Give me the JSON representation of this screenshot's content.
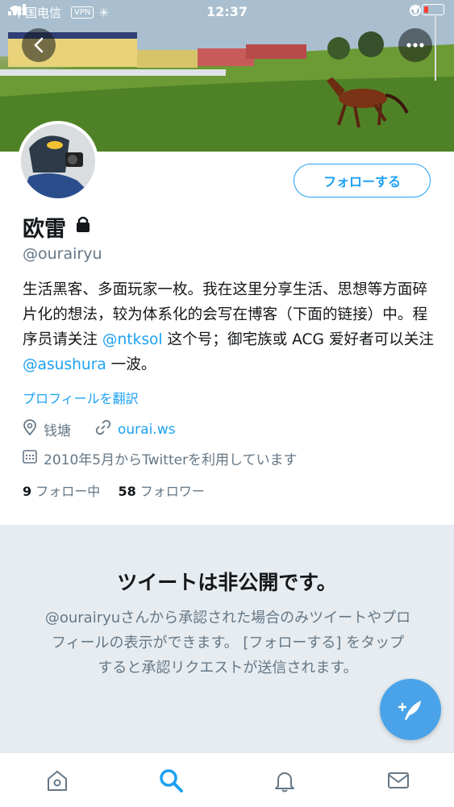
{
  "status_bar": {
    "carrier": "中国电信",
    "vpn": "VPN",
    "time": "12:37"
  },
  "profile": {
    "name": "欧雷",
    "handle": "@ourairyu",
    "follow_label": "フォローする",
    "bio": {
      "part1": "生活黑客、多面玩家一枚。我在这里分享生活、思想等方面碎片化的想法，较为体系化的会写在博客（下面的链接）中。程序员请关注 ",
      "mention1": "@ntksol",
      "part2": " 这个号；御宅族或 ACG 爱好者可以关注 ",
      "mention2": "@asushura",
      "part3": " 一波。"
    },
    "translate_label": "プロフィールを翻訳",
    "location": "钱塘",
    "website": "ourai.ws",
    "joined": "2010年5月からTwitterを利用しています",
    "following_count": "9",
    "following_label": "フォロー中",
    "followers_count": "58",
    "followers_label": "フォロワー"
  },
  "private_notice": {
    "title": "ツイートは非公開です。",
    "body": "@ourairyuさんから承認された場合のみツイートやプロフィールの表示ができます。 [フォローする] をタップすると承認リクエストが送信されます。"
  },
  "icons": [
    "back-icon",
    "more-icon",
    "lock-icon",
    "location-icon",
    "link-icon",
    "calendar-icon",
    "compose-icon",
    "home-icon",
    "search-icon",
    "notifications-icon",
    "messages-icon"
  ],
  "colors": {
    "accent": "#1da1f2",
    "secondary_text": "#657786",
    "private_bg": "#e6ecf0"
  }
}
